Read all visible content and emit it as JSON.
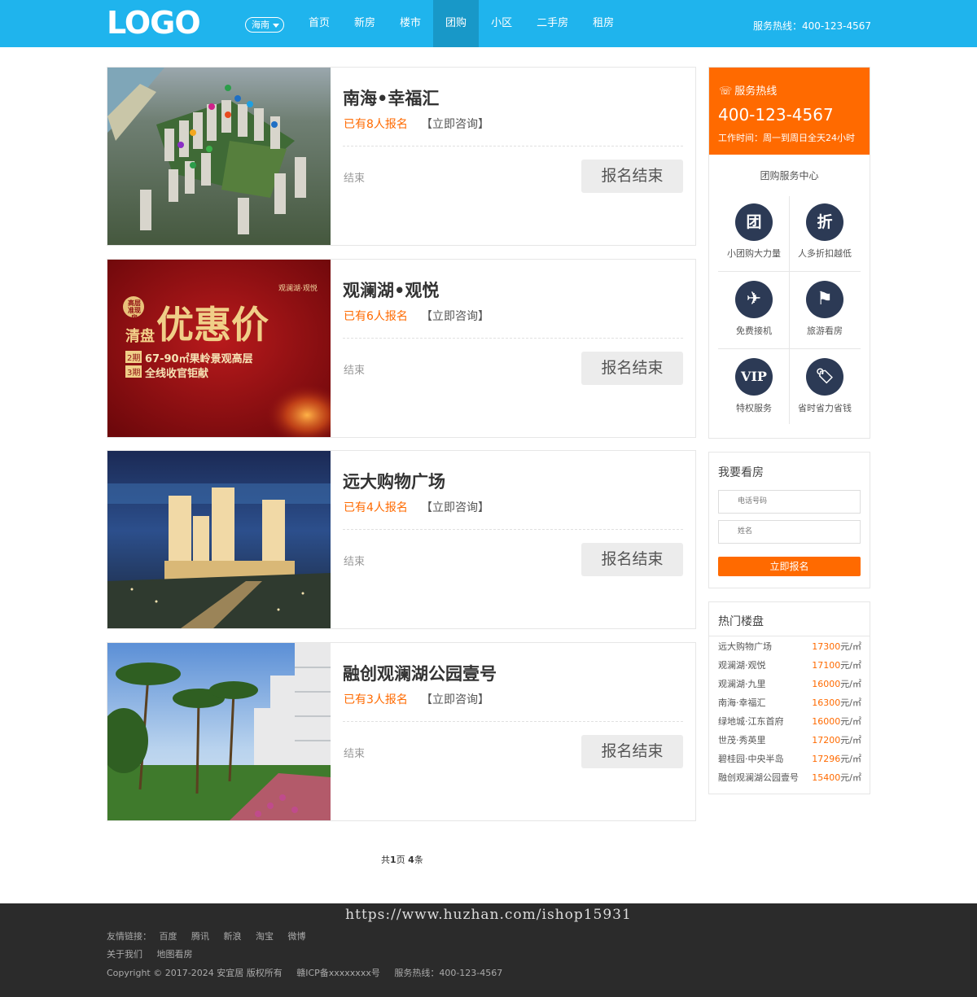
{
  "header": {
    "logo": "LOGO",
    "city": "海南",
    "nav": [
      "首页",
      "新房",
      "楼市",
      "团购",
      "小区",
      "二手房",
      "租房"
    ],
    "active_nav": "团购",
    "hotline": "服务热线：400-123-4567"
  },
  "listings": [
    {
      "name": "南海•幸福汇",
      "signup": "已有8人报名",
      "consult": "【立即咨询】",
      "status": "结束",
      "button": "报名结束",
      "image": "aerial-residential-complex"
    },
    {
      "name": "观澜湖•观悦",
      "signup": "已有6人报名",
      "consult": "【立即咨询】",
      "status": "结束",
      "button": "报名结束",
      "image": "red-promo-banner",
      "banner": {
        "brand": "观澜湖·观悦",
        "tag": "高层准现房",
        "headline": "清盘",
        "price_text": "优惠价",
        "line1": "67-90㎡果岭景观高层",
        "line2": "全线收官钜献",
        "badge1": "2期",
        "badge2": "3期"
      }
    },
    {
      "name": "远大购物广场",
      "signup": "已有4人报名",
      "consult": "【立即咨询】",
      "status": "结束",
      "button": "报名结束",
      "image": "night-shopping-plaza"
    },
    {
      "name": "融创观澜湖公园壹号",
      "signup": "已有3人报名",
      "consult": "【立即咨询】",
      "status": "结束",
      "button": "报名结束",
      "image": "palm-garden-towers"
    }
  ],
  "pager": {
    "prefix": "共",
    "pages": "1",
    "mid": "页 ",
    "count": "4",
    "suffix": "条"
  },
  "sidebar": {
    "hotline_label": "服务热线",
    "hotline_number": "400-123-4567",
    "hours": "工作时间：周一到周日全天24小时",
    "center_title": "团购服务中心",
    "services": [
      {
        "icon": "团",
        "label": "小团购大力量",
        "icon_name": "group-icon"
      },
      {
        "icon": "折",
        "label": "人多折扣越低",
        "icon_name": "discount-icon"
      },
      {
        "icon": "✈",
        "label": "免费接机",
        "icon_name": "airplane-icon"
      },
      {
        "icon": "⚑",
        "label": "旅游看房",
        "icon_name": "flag-icon"
      },
      {
        "icon": "VIP",
        "label": "特权服务",
        "icon_name": "vip-icon"
      },
      {
        "icon": "🏷",
        "label": "省时省力省钱",
        "icon_name": "price-tag-icon"
      }
    ],
    "viewing": {
      "title": "我要看房",
      "phone_placeholder": "电话号码",
      "name_placeholder": "姓名",
      "submit": "立即报名"
    },
    "hot": {
      "title": "热门楼盘",
      "unit": "元/㎡",
      "items": [
        {
          "name": "远大购物广场",
          "price": "17300"
        },
        {
          "name": "观澜湖·观悦",
          "price": "17100"
        },
        {
          "name": "观澜湖·九里",
          "price": "16000"
        },
        {
          "name": "南海·幸福汇",
          "price": "16300"
        },
        {
          "name": "绿地城·江东首府",
          "price": "16000"
        },
        {
          "name": "世茂·秀英里",
          "price": "17200"
        },
        {
          "name": "碧桂园·中央半岛",
          "price": "17296"
        },
        {
          "name": "融创观澜湖公园壹号",
          "price": "15400"
        }
      ]
    }
  },
  "footer": {
    "watermark": "https://www.huzhan.com/ishop15931",
    "friend_label": "友情链接：",
    "friend_links": [
      "百度",
      "腾讯",
      "新浪",
      "淘宝",
      "微博"
    ],
    "about": "关于我们",
    "map": "地图看房",
    "copyright": "Copyright © 2017-2024 安宜居 版权所有",
    "icp": "赣ICP备xxxxxxxx号",
    "hotline": "服务热线：400-123-4567"
  },
  "colors": {
    "header": "#1fb4ed",
    "accent": "#ff6a00",
    "icon_circle": "#2c3a55",
    "footer": "#2b2b2b"
  }
}
